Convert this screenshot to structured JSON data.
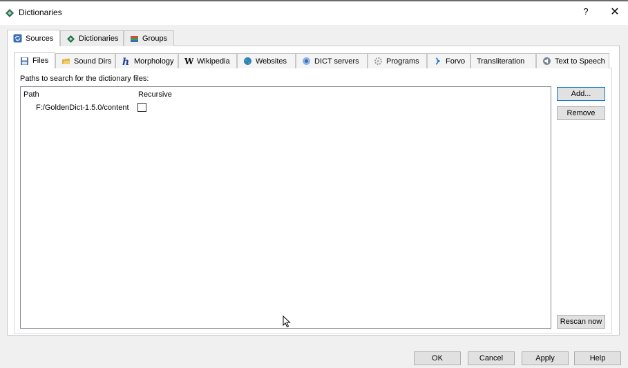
{
  "window": {
    "title": "Dictionaries",
    "help_label": "?",
    "close_label": "✕"
  },
  "outer_tabs": [
    {
      "label": "Sources",
      "icon": "refresh-icon",
      "active": true
    },
    {
      "label": "Dictionaries",
      "icon": "dictionary-icon",
      "active": false
    },
    {
      "label": "Groups",
      "icon": "books-icon",
      "active": false
    }
  ],
  "inner_tabs": [
    {
      "label": "Files",
      "icon": "floppy-icon",
      "active": true
    },
    {
      "label": "Sound Dirs",
      "icon": "folder-sound-icon"
    },
    {
      "label": "Morphology",
      "icon": "h-letter-icon"
    },
    {
      "label": "Wikipedia",
      "icon": "wikipedia-icon"
    },
    {
      "label": "Websites",
      "icon": "globe-icon"
    },
    {
      "label": "DICT servers",
      "icon": "server-icon"
    },
    {
      "label": "Programs",
      "icon": "gear-icon"
    },
    {
      "label": "Forvo",
      "icon": "forvo-icon"
    },
    {
      "label": "Transliteration",
      "icon": ""
    },
    {
      "label": "Text to Speech",
      "icon": "speaker-icon"
    }
  ],
  "files": {
    "label": "Paths to search for the dictionary files:",
    "columns": {
      "path": "Path",
      "recursive": "Recursive"
    },
    "rows": [
      {
        "path": "F:/GoldenDict-1.5.0/content",
        "recursive": false
      }
    ],
    "add_label": "Add...",
    "remove_label": "Remove",
    "rescan_label": "Rescan now"
  },
  "footer": {
    "ok_label": "OK",
    "cancel_label": "Cancel",
    "apply_label": "Apply",
    "help_label": "Help"
  },
  "colors": {
    "focus_border": "#0078d7",
    "panel_background": "#ffffff",
    "dialog_background": "#f0f0f0"
  }
}
